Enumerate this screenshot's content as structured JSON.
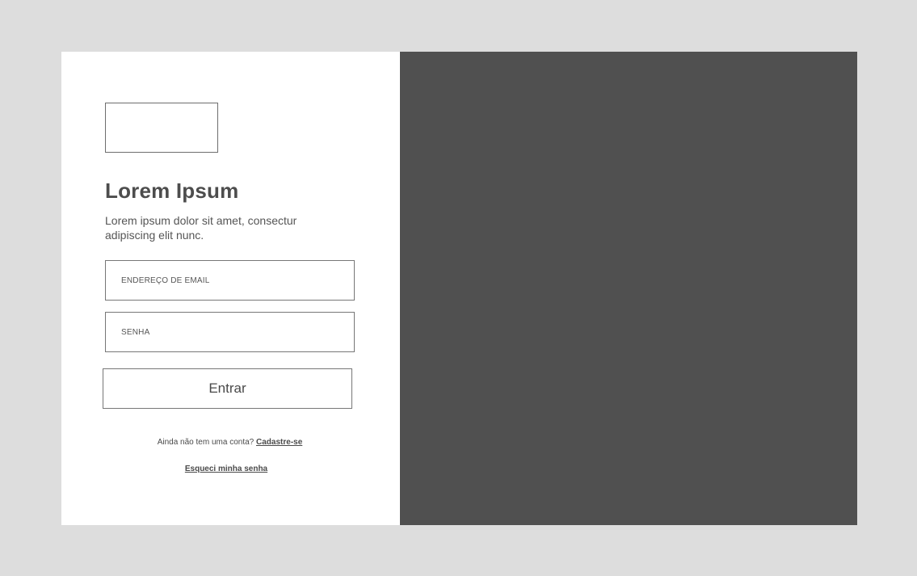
{
  "login": {
    "title": "Lorem Ipsum",
    "description": "Lorem ipsum dolor sit amet, consectur adipiscing elit nunc.",
    "email": {
      "placeholder": "ENDEREÇO DE EMAIL",
      "value": ""
    },
    "password": {
      "placeholder": "SENHA",
      "value": ""
    },
    "submit_label": "Entrar",
    "signup_prompt": "Ainda não tem uma conta?",
    "signup_link": "Cadastre-se",
    "forgot_link": "Esqueci minha senha"
  },
  "colors": {
    "page_background": "#dddddd",
    "card_background": "#ffffff",
    "image_panel": "#505050",
    "text": "#4a4a4a",
    "border": "#777777"
  }
}
